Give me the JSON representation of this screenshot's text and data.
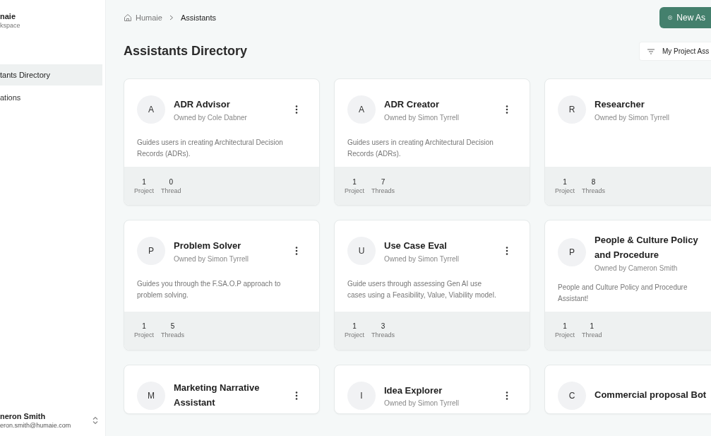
{
  "sidebar": {
    "workspace": {
      "name": "naie",
      "subtitle": "kspace"
    },
    "items": [
      {
        "label": "tants Directory",
        "selected": true
      },
      {
        "label": "ations",
        "selected": false
      }
    ],
    "user": {
      "name": "neron Smith",
      "email": "eron.smith@humaie.com"
    }
  },
  "breadcrumb": [
    "Humaie",
    "Assistants"
  ],
  "new_button": "New As",
  "title": "Assistants Directory",
  "filter": "My Project Ass",
  "cards": [
    {
      "initial": "A",
      "name": "ADR Advisor",
      "owner": "Owned by Cole Dabner",
      "description": "Guides users in creating Architectural Decision Records (ADRs).",
      "projects": "1",
      "projects_label": "Project",
      "threads": "0",
      "threads_label": "Thread"
    },
    {
      "initial": "A",
      "name": "ADR Creator",
      "owner": "Owned by Simon Tyrrell",
      "description": "Guides users in creating Architectural Decision Records (ADRs).",
      "projects": "1",
      "projects_label": "Project",
      "threads": "7",
      "threads_label": "Threads"
    },
    {
      "initial": "R",
      "name": "Researcher",
      "owner": "Owned by Simon Tyrrell",
      "projects": "1",
      "projects_label": "Project",
      "threads": "8",
      "threads_label": "Threads"
    },
    {
      "initial": "P",
      "name": "Problem Solver",
      "owner": "Owned by Simon Tyrrell",
      "description": "Guides you through the F.SA.O.P approach to problem solving.",
      "projects": "1",
      "projects_label": "Project",
      "threads": "5",
      "threads_label": "Threads"
    },
    {
      "initial": "U",
      "name": "Use Case Eval",
      "owner": "Owned by Simon Tyrrell",
      "description": "Guide users through assessing Gen AI use cases using a Feasibility, Value, Viability model.",
      "projects": "1",
      "projects_label": "Project",
      "threads": "3",
      "threads_label": "Threads"
    },
    {
      "initial": "P",
      "name": "People & Culture Policy and Procedure",
      "owner": "Owned by Cameron Smith",
      "description": "People and Culture Policy and Procedure Assistant!",
      "projects": "1",
      "projects_label": "Project",
      "threads": "1",
      "threads_label": "Thread"
    },
    {
      "initial": "M",
      "name": "Marketing Narrative Assistant"
    },
    {
      "initial": "I",
      "name": "Idea Explorer",
      "owner": "Owned by Simon Tyrrell"
    },
    {
      "initial": "C",
      "name": "Commercial proposal Bot"
    }
  ]
}
